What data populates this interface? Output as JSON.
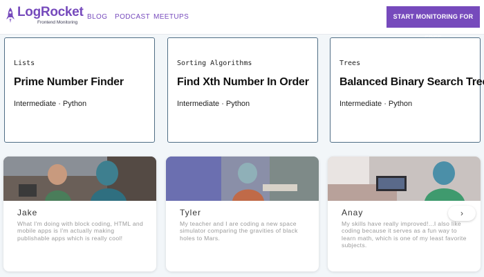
{
  "header": {
    "logo_text": "LogRocket",
    "logo_tagline": "Frontend Monitoring",
    "nav": [
      "BLOG",
      "PODCAST",
      "MEETUPS"
    ],
    "cta_label": "START MONITORING FOR FREE"
  },
  "courses": [
    {
      "category": "Lists",
      "title": "Prime Number Finder",
      "meta": "Intermediate · Python"
    },
    {
      "category": "Sorting Algorithms",
      "title": "Find Xth Number In Order",
      "meta": "Intermediate · Python"
    },
    {
      "category": "Trees",
      "title": "Balanced Binary Search Tree",
      "meta": "Intermediate · Python"
    }
  ],
  "testimonials": [
    {
      "name": "Jake",
      "quote": "What I'm doing with block coding, HTML and mobile apps is I'm actually making publishable apps which is really cool!"
    },
    {
      "name": "Tyler",
      "quote": "My teacher and I are coding a new space simulator comparing the gravities of black holes to Mars."
    },
    {
      "name": "Anay",
      "quote": "My skills have really improved!...I also like coding because it serves as a fun way to learn math, which is one of my least favorite subjects."
    }
  ],
  "carousel": {
    "next_glyph": "›"
  },
  "colors": {
    "brand": "#764abc",
    "card_border": "#4f6d84"
  },
  "icons": [
    "rocket-logo-icon",
    "chevron-right-icon"
  ]
}
